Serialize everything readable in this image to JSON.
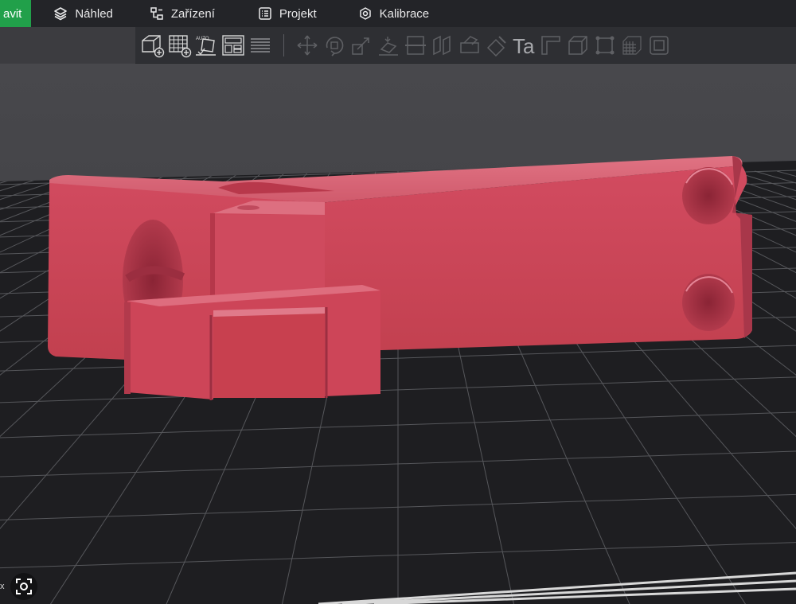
{
  "topbar": {
    "tabs": [
      {
        "label": "avit",
        "icon": "none",
        "active": true
      },
      {
        "label": "Náhled",
        "icon": "layers-icon"
      },
      {
        "label": "Zařízení",
        "icon": "device-icon"
      },
      {
        "label": "Projekt",
        "icon": "project-icon"
      },
      {
        "label": "Kalibrace",
        "icon": "calibration-icon"
      }
    ]
  },
  "toolbar": {
    "enabled_tools": [
      "add-object-icon",
      "add-plate-icon",
      "auto-orient-icon",
      "arrange-icon",
      "slice-layers-icon"
    ],
    "disabled_tools": [
      "move-icon",
      "rotate-icon",
      "scale-icon",
      "lay-on-face-icon",
      "cut-icon",
      "split-icon",
      "support-paint-icon",
      "seam-paint-icon",
      "text-icon",
      "measure-icon",
      "boolean-icon",
      "assembly-icon",
      "mesh-icon",
      "variable-layer-icon"
    ],
    "text_tool_glyph": "Ta",
    "auto_label": "AUTO"
  },
  "viewport": {
    "background_color": "#3c3c40",
    "bed_color": "#1c1c1e",
    "grid_color": "#5a5b5f",
    "model_color": "#c8475a"
  },
  "overlay": {
    "scan_button": "scan-icon",
    "edge_mark": "x"
  }
}
